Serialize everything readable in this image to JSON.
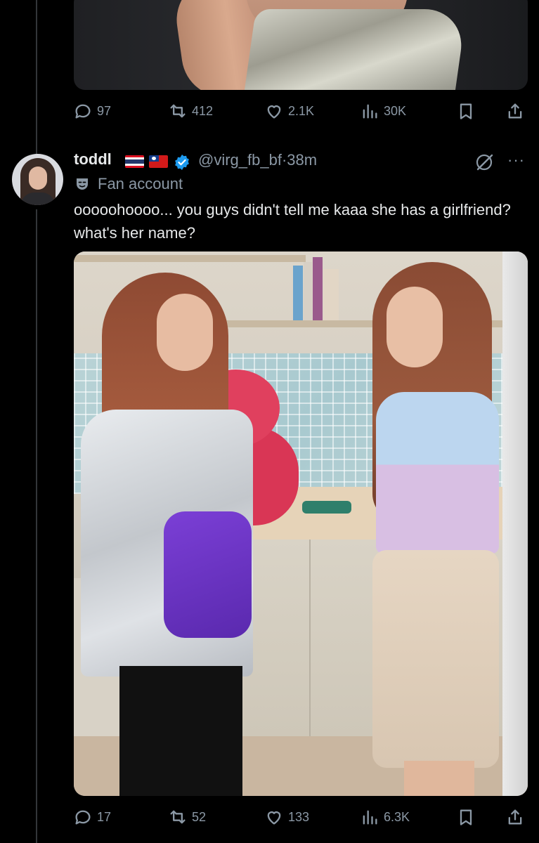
{
  "previous_tweet": {
    "actions": {
      "replies": "97",
      "reposts": "412",
      "likes": "2.1K",
      "views": "30K"
    }
  },
  "tweet": {
    "display_name": "toddl",
    "flags": [
      "thailand-flag",
      "taiwan-flag"
    ],
    "handle": "@virg_fb_bf",
    "separator": "·",
    "timestamp": "38m",
    "label": "Fan account",
    "text": "ooooohoooo... you guys didn't tell me kaaa she has a girlfriend? what's her name?",
    "actions": {
      "replies": "17",
      "reposts": "52",
      "likes": "133",
      "views": "6.3K"
    }
  },
  "icons": {
    "reply": "reply-icon",
    "repost": "repost-icon",
    "like": "heart-icon",
    "views": "views-icon",
    "bookmark": "bookmark-icon",
    "share": "share-icon",
    "verified": "verified-badge-icon",
    "grok": "grok-icon",
    "more": "more-icon",
    "label": "parody-mask-icon"
  },
  "colors": {
    "background": "#000000",
    "text": "#e7e9ea",
    "muted": "#8b98a5",
    "verified": "#1d9bf0"
  }
}
